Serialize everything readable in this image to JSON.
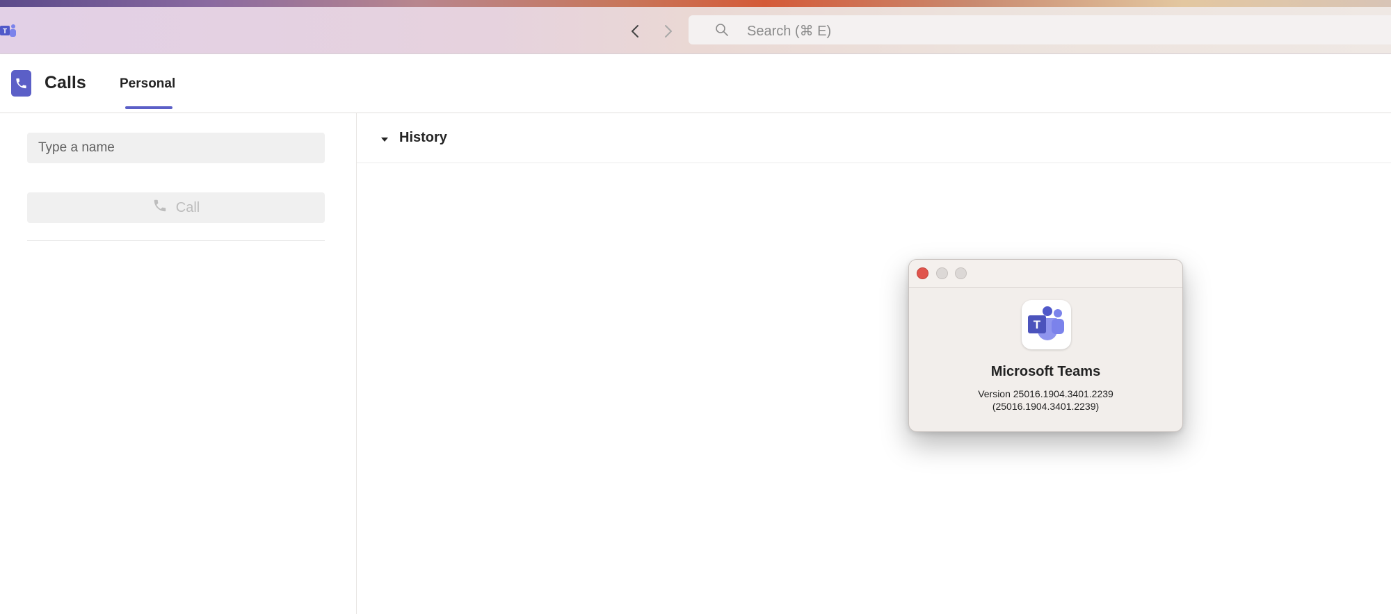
{
  "window": {
    "search_placeholder": "Search (⌘ E)"
  },
  "header": {
    "app_title": "Calls",
    "tabs": [
      {
        "label": "Personal",
        "selected": true
      }
    ]
  },
  "dialer": {
    "name_placeholder": "Type a name",
    "call_label": "Call"
  },
  "history": {
    "label": "History",
    "expanded": true
  },
  "about_dialog": {
    "app_name": "Microsoft Teams",
    "version_line1": "Version 25016.1904.3401.2239",
    "version_line2": "(25016.1904.3401.2239)"
  },
  "colors": {
    "accent": "#5b5fc7",
    "close_red": "#e0544c"
  }
}
